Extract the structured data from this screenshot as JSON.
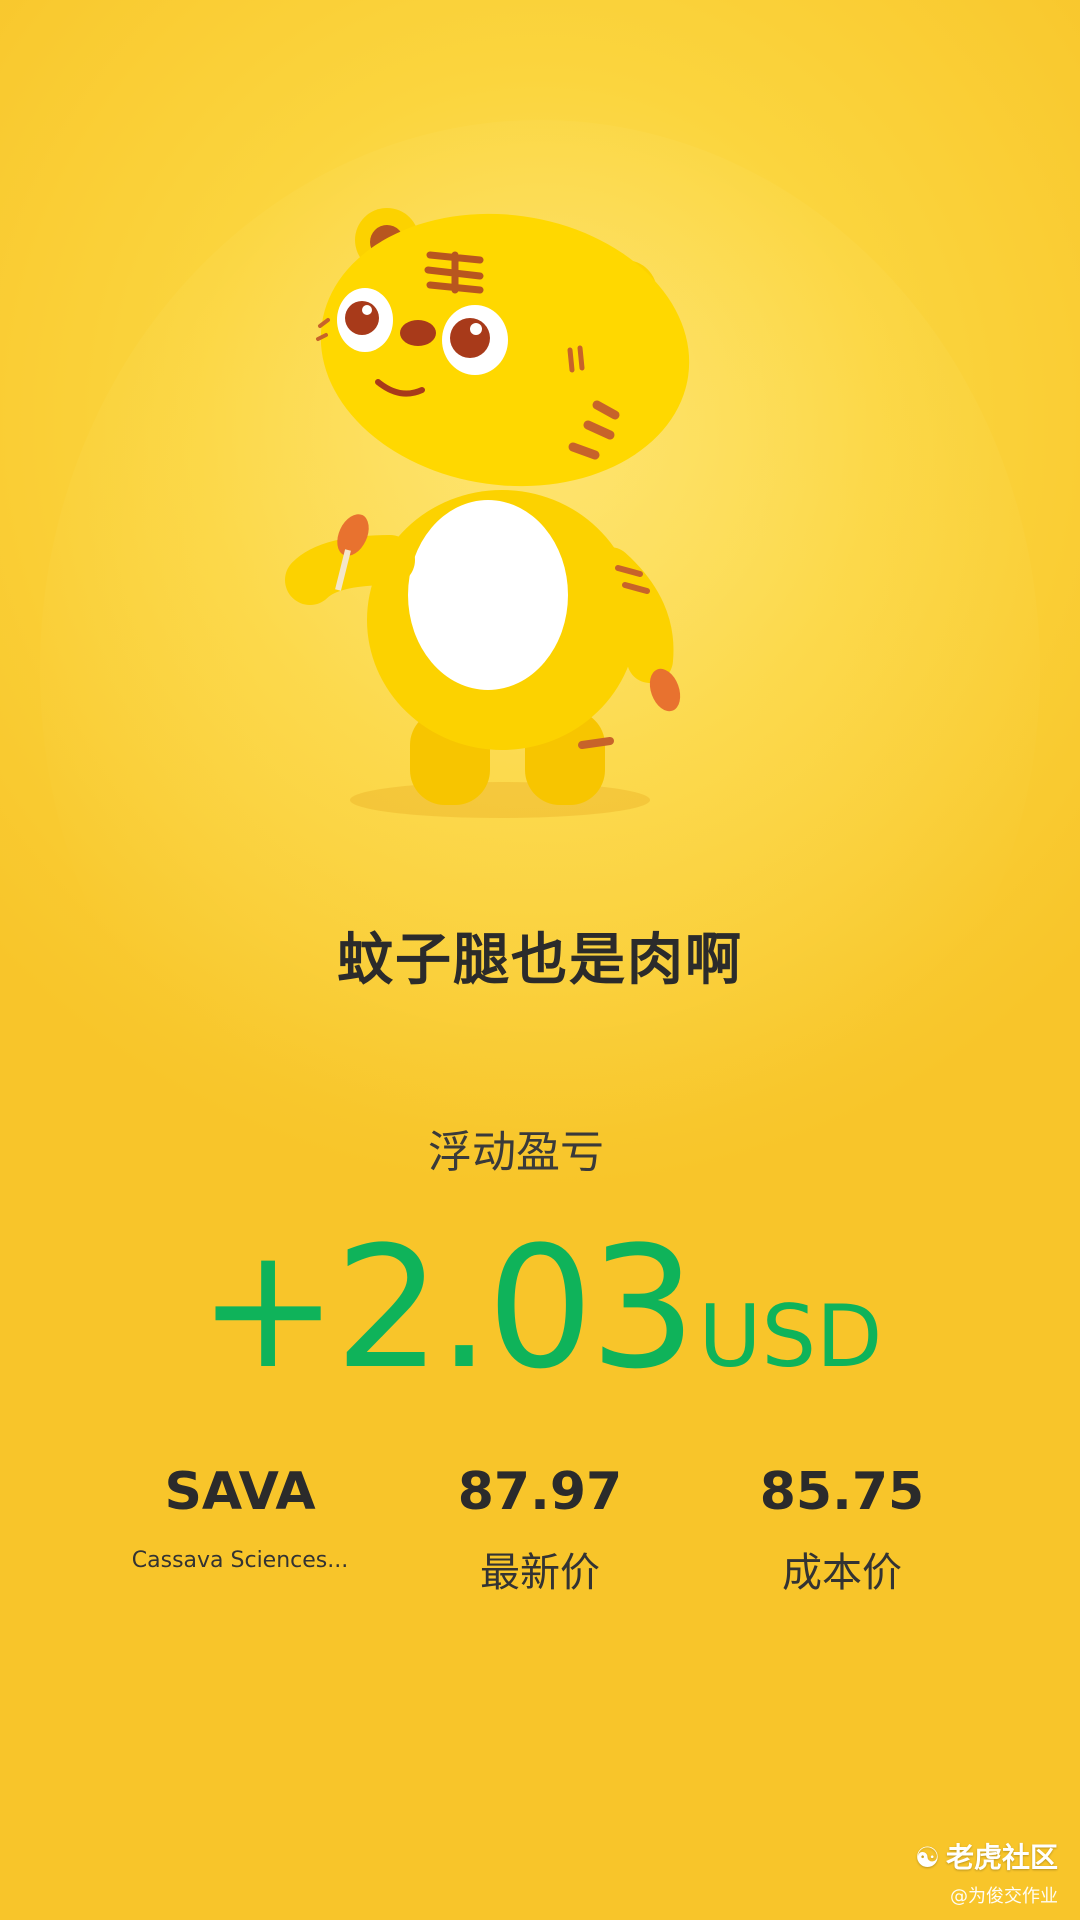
{
  "nickname": "蚊子腿也是肉啊",
  "floating_pl": {
    "label": "浮动盈亏",
    "value": "+2.03",
    "unit": "USD"
  },
  "stock": {
    "ticker": "SAVA",
    "name": "Cassava Sciences..."
  },
  "latest_price": {
    "value": "87.97",
    "label": "最新价"
  },
  "cost_price": {
    "value": "85.75",
    "label": "成本价"
  },
  "watermark": {
    "brand": "老虎社区",
    "user": "@为俊交作业"
  },
  "colors": {
    "background": "#fbd53e",
    "profit_green": "#0fb35a",
    "text_dark": "#2b2b2b"
  },
  "icons": {
    "mascot": "tiger-mascot",
    "brand_logo": "tiger-paw-icon"
  }
}
